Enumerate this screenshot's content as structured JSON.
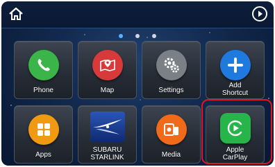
{
  "header": {
    "home_icon": "home-icon",
    "play_icon": "play-icon"
  },
  "pager": {
    "pages": 3,
    "current": 1
  },
  "apps": [
    {
      "label": "Phone",
      "icon": "phone-icon",
      "color": "#3bb44a"
    },
    {
      "label": "Map",
      "icon": "map-pin-icon",
      "color": "#d63a3a"
    },
    {
      "label": "Settings",
      "icon": "gears-icon",
      "color": "#7b7f86"
    },
    {
      "label": "Add\nShortcut",
      "icon": "plus-icon",
      "color": "#1f7ae0"
    },
    {
      "label": "Apps",
      "icon": "grid-icon",
      "color": "#f09a12"
    },
    {
      "label": "SUBARU\nSTARLINK",
      "icon": "starlink-logo",
      "color": "#1c3c8c"
    },
    {
      "label": "Media",
      "icon": "media-icon",
      "color": "#f06a1a"
    },
    {
      "label": "Apple\nCarPlay",
      "icon": "carplay-icon",
      "color": "#27b54a"
    }
  ],
  "highlight_color": "#e01622"
}
